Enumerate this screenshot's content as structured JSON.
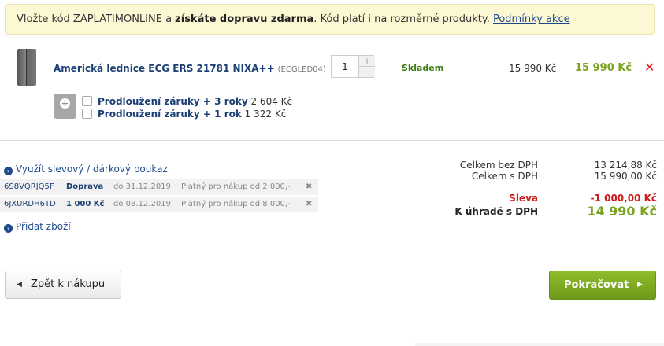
{
  "promo": {
    "text_pre": "Vložte kód ZAPLATIMONLINE a ",
    "text_bold": "získáte dopravu zdarma",
    "text_post": ". Kód platí i na rozměrné produkty. ",
    "link": "Podmínky akce"
  },
  "product": {
    "name": "Americká lednice ECG ERS 21781 NIXA++",
    "code": "(ECGLED04)",
    "quantity": "1",
    "qty_up": "+",
    "qty_down": "−",
    "stock": "Skladem",
    "unit_price": "15 990 Kč",
    "total_price": "15 990 Kč",
    "remove_icon": "✕"
  },
  "warranties": [
    {
      "label": "Prodloužení záruky + 3 roky",
      "price": "2 604 Kč"
    },
    {
      "label": "Prodloužení záruky + 1 rok",
      "price": "1 322 Kč"
    }
  ],
  "voucher_link": "Využít slevový / dárkový poukaz",
  "vouchers": [
    {
      "code": "6S8VQRJQ5F",
      "type": "Doprava",
      "date": "do 31.12.2019",
      "note": "Platný pro nákup od 2 000,-"
    },
    {
      "code": "6JXURDH6TD",
      "type": "1 000 Kč",
      "date": "do 08.12.2019",
      "note": "Platný pro nákup od 8 000,-"
    }
  ],
  "add_link": "Přidat zboží",
  "summary": {
    "total_no_vat_label": "Celkem bez DPH",
    "total_no_vat": "13 214,88 Kč",
    "total_vat_label": "Celkem s DPH",
    "total_vat": "15 990,00 Kč",
    "discount_label": "Sleva",
    "discount": "-1 000,00 Kč",
    "pay_label": "K úhradě s DPH",
    "pay": "14 990 Kč"
  },
  "buttons": {
    "back": "Zpět k nákupu",
    "next": "Pokračovat"
  },
  "icons": {
    "fridge": "fridge-image",
    "warranty": "warranty-badge-icon",
    "remove": "remove-icon",
    "chevron": "chevron-right-icon",
    "back": "chevron-left-icon"
  },
  "colors": {
    "accent_green": "#7aa523",
    "link_blue": "#1c4a8c",
    "danger_red": "#d01b1b",
    "promo_bg": "#fdf8d4"
  }
}
